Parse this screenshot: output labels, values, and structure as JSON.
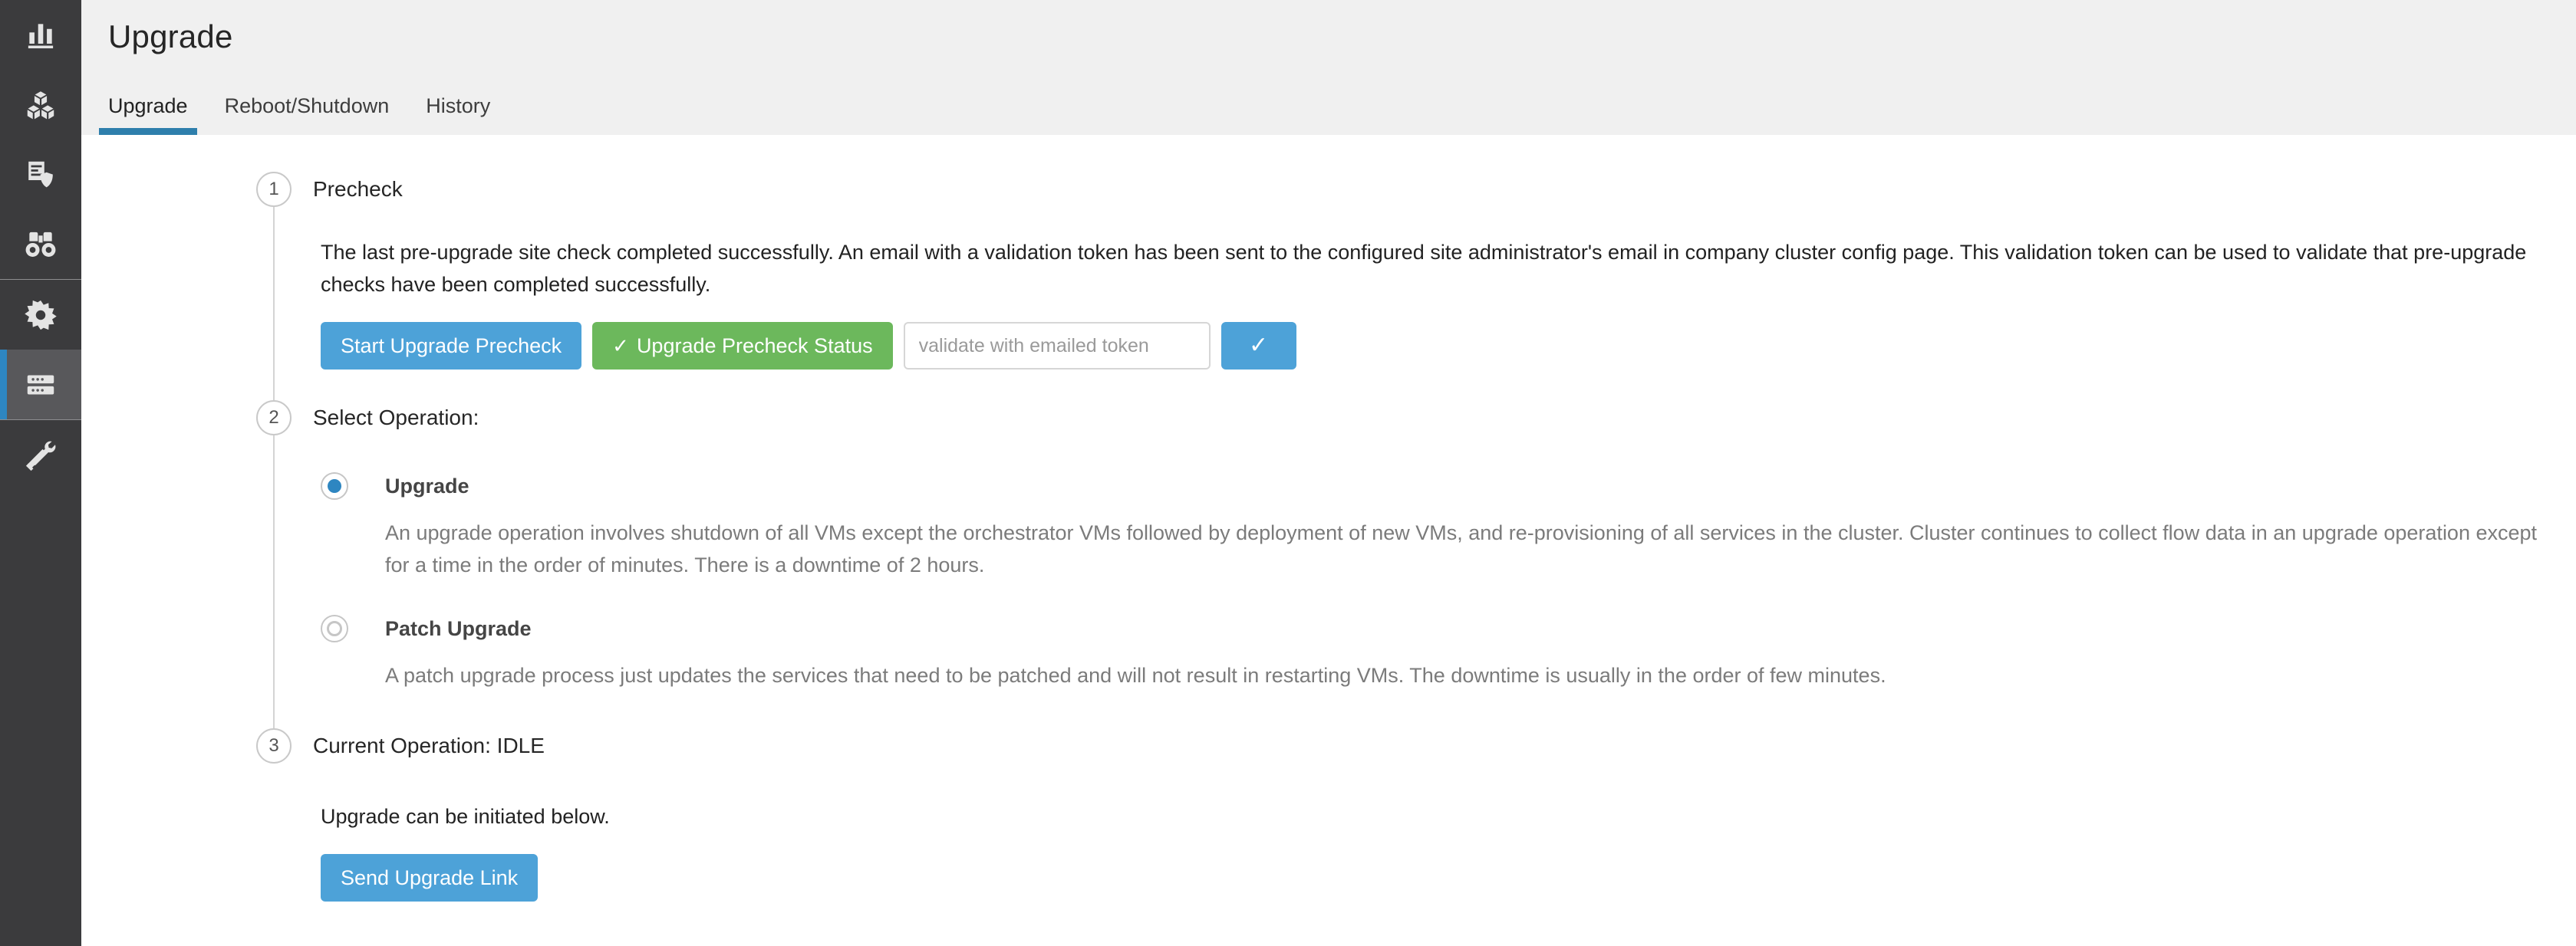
{
  "sidebar": {
    "items": [
      {
        "id": "dashboard",
        "icon": "bar-chart-icon",
        "active": false
      },
      {
        "id": "inventory",
        "icon": "cubes-icon",
        "active": false
      },
      {
        "id": "policy",
        "icon": "document-shield-icon",
        "active": false
      },
      {
        "id": "investigate",
        "icon": "binoculars-icon",
        "active": false
      },
      {
        "id": "settings",
        "icon": "gear-icon",
        "active": false
      },
      {
        "id": "platform",
        "icon": "server-icon",
        "active": true
      },
      {
        "id": "maintenance",
        "icon": "tools-icon",
        "active": false
      }
    ],
    "accent_color": "#2e86c1",
    "background_color": "#3b3b3d",
    "active_background_color": "#58585b"
  },
  "header": {
    "title": "Upgrade"
  },
  "tabs": [
    {
      "label": "Upgrade",
      "active": true
    },
    {
      "label": "Reboot/Shutdown",
      "active": false
    },
    {
      "label": "History",
      "active": false
    }
  ],
  "steps": {
    "precheck": {
      "number": "1",
      "title": "Precheck",
      "description": "The last pre-upgrade site check completed successfully. An email with a validation token has been sent to the configured site administrator's email in company cluster config page. This validation token can be used to validate that pre-upgrade checks have been completed successfully.",
      "start_button": "Start Upgrade Precheck",
      "status_button": "Upgrade Precheck Status",
      "status_button_icon": "check-icon",
      "token_placeholder": "validate with emailed token",
      "token_value": "",
      "validate_button_icon": "check-icon",
      "start_button_color": "#4da2d8",
      "status_button_color": "#6cb85c"
    },
    "select_operation": {
      "number": "2",
      "title": "Select Operation:",
      "options": [
        {
          "label": "Upgrade",
          "selected": true,
          "description": "An upgrade operation involves shutdown of all VMs except the orchestrator VMs followed by deployment of new VMs, and re-provisioning of all services in the cluster. Cluster continues to collect flow data in an upgrade operation except for a time in the order of minutes. There is a downtime of 2 hours."
        },
        {
          "label": "Patch Upgrade",
          "selected": false,
          "description": "A patch upgrade process just updates the services that need to be patched and will not result in restarting VMs. The downtime is usually in the order of few minutes."
        }
      ]
    },
    "current_operation": {
      "number": "3",
      "title": "Current Operation: IDLE",
      "message": "Upgrade can be initiated below.",
      "send_button": "Send Upgrade Link",
      "send_button_color": "#4da2d8"
    }
  }
}
